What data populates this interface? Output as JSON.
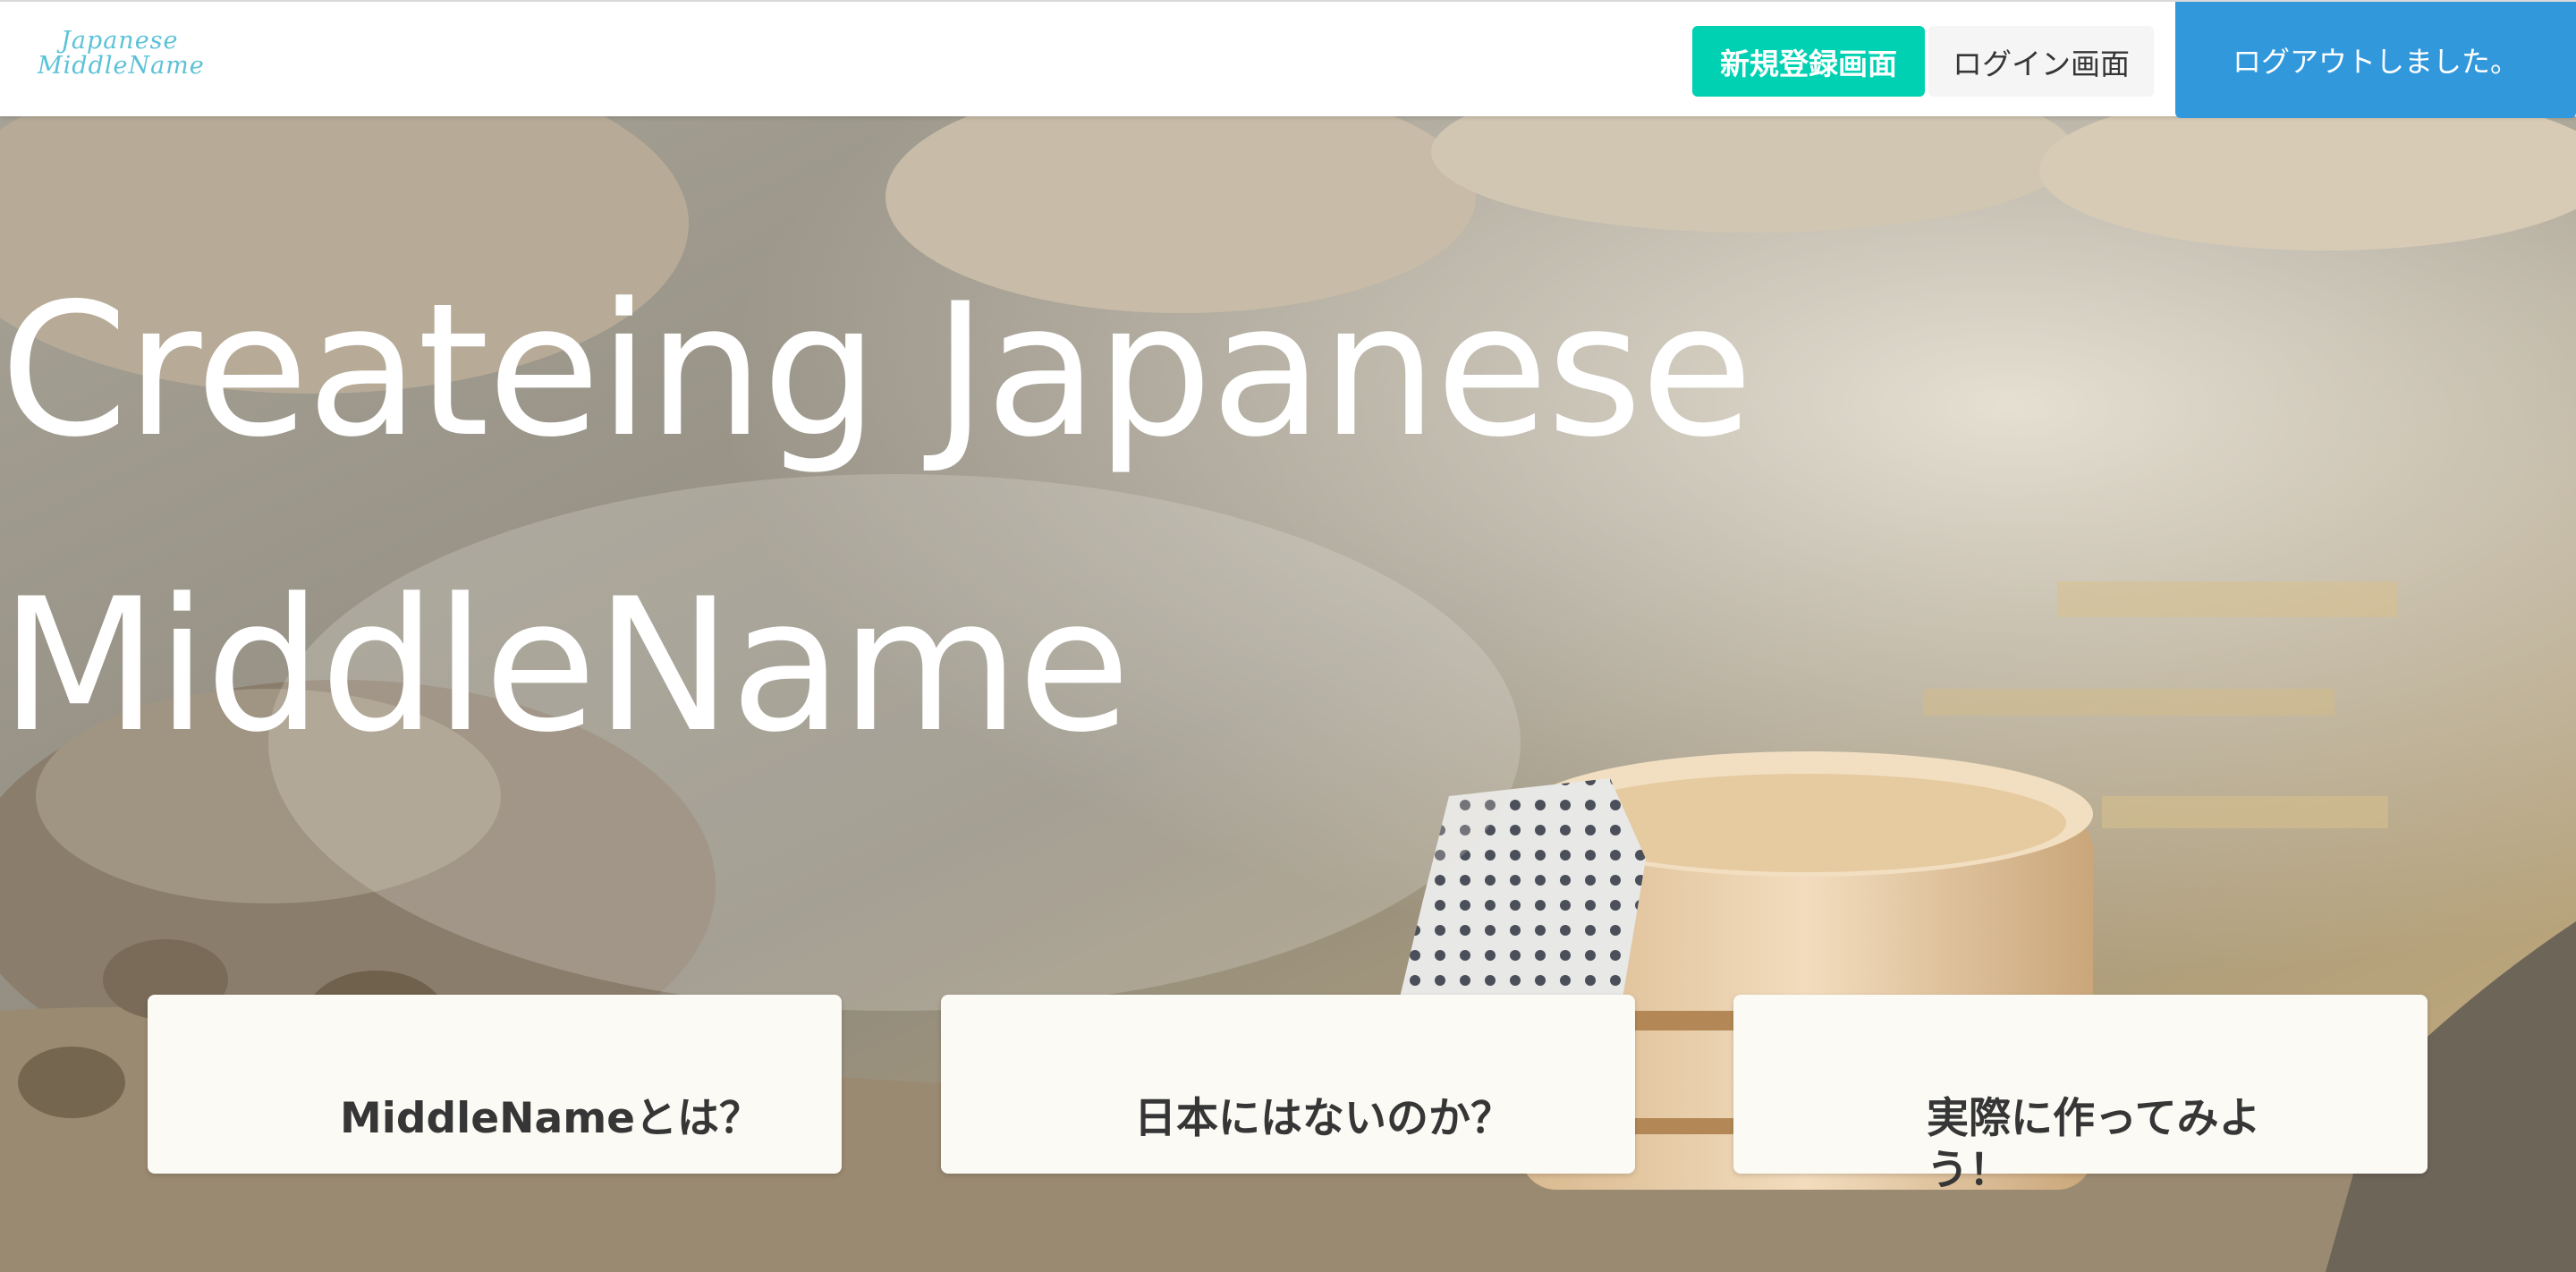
{
  "navbar": {
    "logo_line1": "Japanese",
    "logo_line2": "MiddleName",
    "register_label": "新規登録画面",
    "login_label": "ログイン画面",
    "logout_label": "ログアウトしました。"
  },
  "hero": {
    "title_line1": "Createing Japanese",
    "title_line2": "MiddleName"
  },
  "cards": [
    {
      "title": "MiddleNameとは？"
    },
    {
      "title": "日本にはないのか？"
    },
    {
      "title": "実際に作ってみよう！"
    }
  ],
  "colors": {
    "register": "#00d1b2",
    "login": "#f5f5f5",
    "logout": "#3298dc",
    "logo": "#5cc2d6"
  }
}
